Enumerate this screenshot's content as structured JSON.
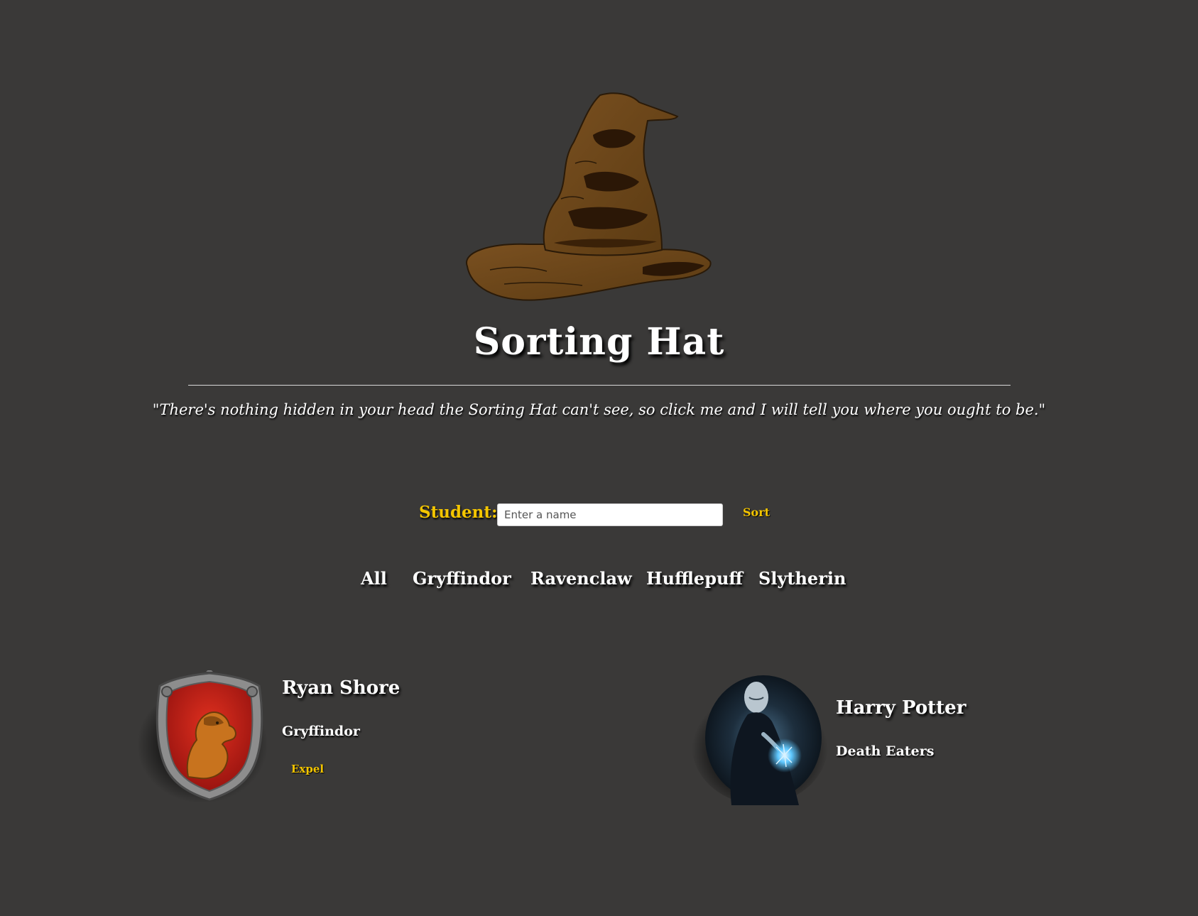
{
  "header": {
    "title": "Sorting Hat",
    "quote": "\"There's nothing hidden in your head the Sorting Hat can't see, so click me and I will tell you where you ought to be.\""
  },
  "form": {
    "label": "Student:",
    "input_value": "",
    "input_placeholder": "Enter a name",
    "sort_label": "Sort"
  },
  "filters": [
    "All",
    "Gryffindor",
    "Ravenclaw",
    "Hufflepuff",
    "Slytherin"
  ],
  "students": [
    {
      "name": "Ryan Shore",
      "house": "Gryffindor",
      "action_label": "Expel",
      "image": "gryffindor-crest"
    },
    {
      "name": "Harry Potter",
      "house": "Death Eaters",
      "image": "death-eater-portrait"
    }
  ],
  "colors": {
    "background": "#3a3938",
    "accent": "#f3c500",
    "text": "#ffffff",
    "hat": "#6b4416"
  }
}
